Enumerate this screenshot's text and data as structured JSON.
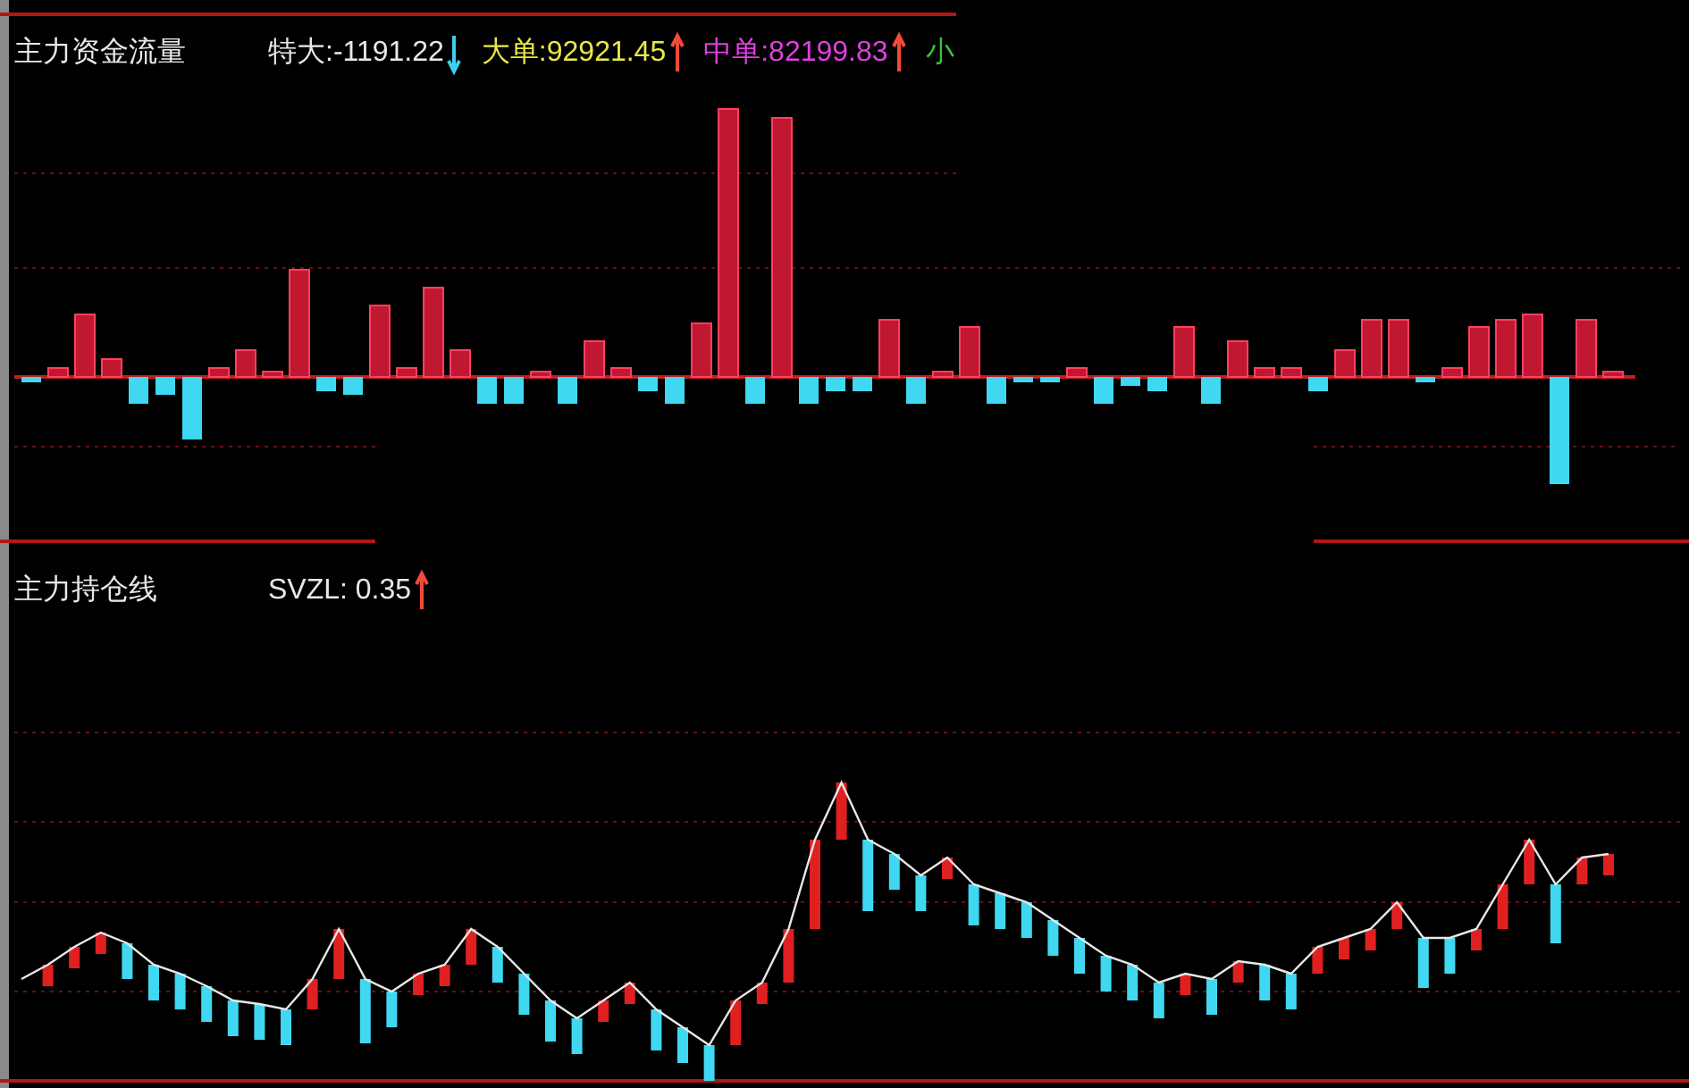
{
  "top_panel": {
    "title": "主力资金流量",
    "legend": [
      {
        "label": "特大:-1191.22",
        "color": "#e8e8e8",
        "rising": false
      },
      {
        "label": "大单:92921.45",
        "color": "#e8e84a",
        "rising": true
      },
      {
        "label": "中单:82199.83",
        "color": "#e040e0",
        "rising": true
      },
      {
        "label": "小",
        "color": "#3cc03c"
      }
    ]
  },
  "bottom_panel": {
    "title": "主力持仓线",
    "legend": [
      {
        "label": "SVZL: 0.35",
        "color": "#e8e8e8",
        "rising": true
      }
    ]
  }
}
